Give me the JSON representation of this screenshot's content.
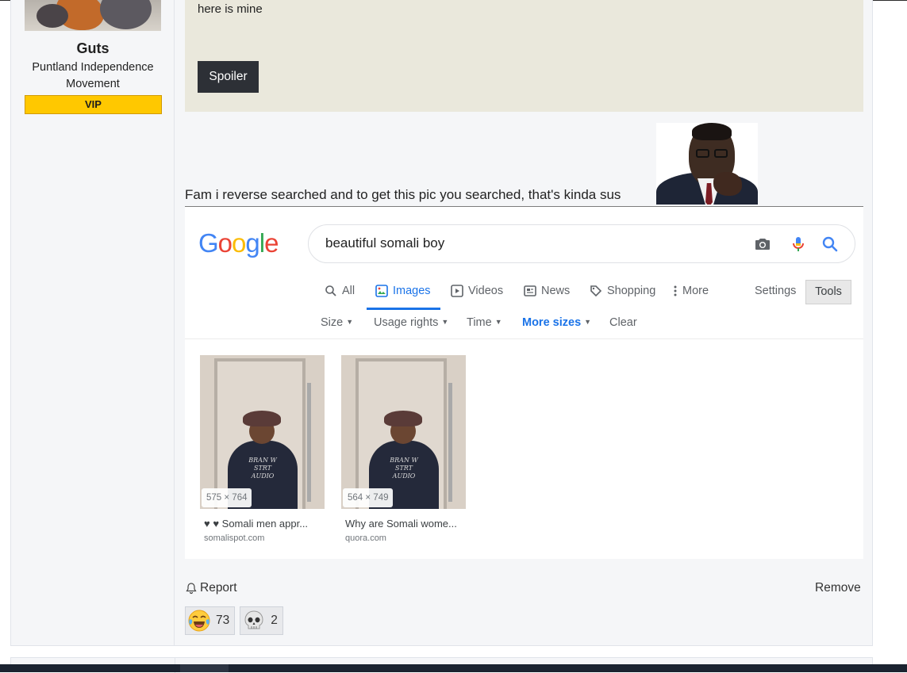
{
  "user": {
    "name": "Guts",
    "title": "Puntland Independence Movement",
    "badge": "VIP"
  },
  "quote": {
    "text": "here is mine",
    "spoiler_label": "Spoiler"
  },
  "message": {
    "text": "Fam i reverse searched and to get this pic you searched, that's kinda sus"
  },
  "google": {
    "logo": "Google",
    "query": "beautiful somali boy",
    "tabs": [
      {
        "label": "All",
        "icon": "search-icon"
      },
      {
        "label": "Images",
        "icon": "image-icon",
        "active": true
      },
      {
        "label": "Videos",
        "icon": "video-icon"
      },
      {
        "label": "News",
        "icon": "news-icon"
      },
      {
        "label": "Shopping",
        "icon": "tag-icon"
      },
      {
        "label": "More",
        "icon": "more-vert-icon"
      }
    ],
    "settings_label": "Settings",
    "tools_label": "Tools",
    "filters": [
      {
        "label": "Size"
      },
      {
        "label": "Usage rights"
      },
      {
        "label": "Time"
      },
      {
        "label": "More sizes",
        "active": true
      },
      {
        "label": "Clear"
      }
    ],
    "results": [
      {
        "dims": "575 × 764",
        "caption": "♥ ♥ Somali men appr...",
        "source": "somalispot.com",
        "shirt": "BRAN W\nSTRT\nAUDIO"
      },
      {
        "dims": "564 × 749",
        "caption": "Why are Somali wome...",
        "source": "quora.com",
        "shirt": "BRAN W\nSTRT\nAUDIO"
      }
    ],
    "colors": {
      "blue": "#4285F4",
      "red": "#EA4335",
      "yellow": "#FBBC05",
      "green": "#34A853",
      "active": "#1a73e8"
    }
  },
  "actions": {
    "report_label": "Report",
    "remove_label": "Remove"
  },
  "reactions": [
    {
      "icon": "laughing-tears-emoji",
      "count": "73"
    },
    {
      "icon": "skull-emoji",
      "count": "2"
    }
  ]
}
